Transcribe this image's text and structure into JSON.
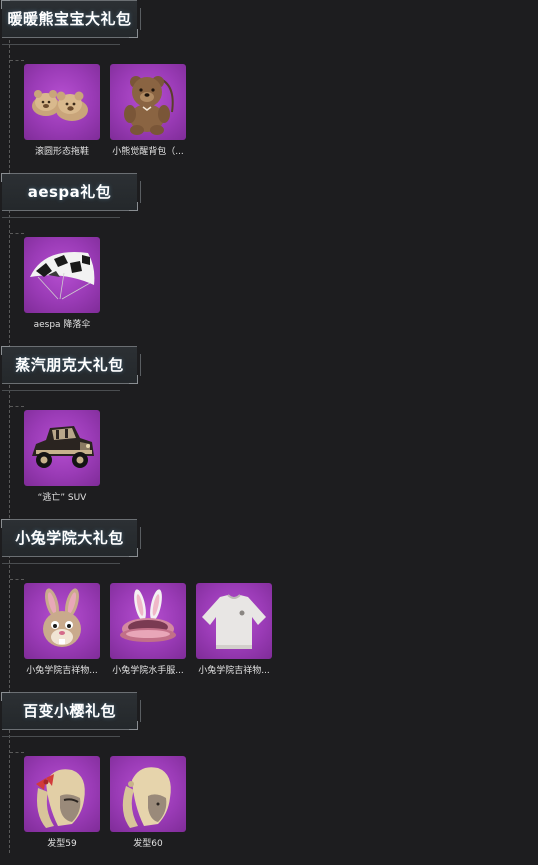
{
  "sections": [
    {
      "title": "暖暖熊宝宝大礼包",
      "items": [
        {
          "name": "滚圆形态拖鞋",
          "icon": "bear-slippers-icon"
        },
        {
          "name": "小熊觉醒背包（...",
          "icon": "bear-backpack-icon"
        }
      ]
    },
    {
      "title": "aespa礼包",
      "items": [
        {
          "name": "aespa 降落伞",
          "icon": "parachute-icon"
        }
      ]
    },
    {
      "title": "蒸汽朋克大礼包",
      "items": [
        {
          "name": "“逃亡” SUV",
          "icon": "vintage-car-icon"
        }
      ]
    },
    {
      "title": "小兔学院大礼包",
      "items": [
        {
          "name": "小兔学院吉祥物...",
          "icon": "rabbit-mask-icon"
        },
        {
          "name": "小兔学院水手服...",
          "icon": "bunny-ear-hat-icon"
        },
        {
          "name": "小兔学院吉祥物...",
          "icon": "white-sweater-icon"
        }
      ]
    },
    {
      "title": "百变小樱礼包",
      "items": [
        {
          "name": "发型59",
          "icon": "ponytail-bow-hairstyle-icon"
        },
        {
          "name": "发型60",
          "icon": "ponytail-hairstyle-icon"
        }
      ]
    }
  ],
  "colors": {
    "background": "#1d1d1f",
    "item_bg": "#9a3bb6",
    "header_bg": "#2c3034"
  }
}
